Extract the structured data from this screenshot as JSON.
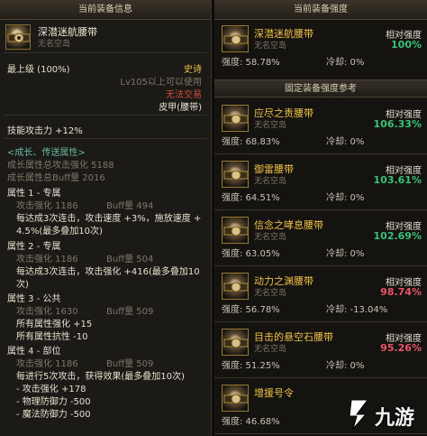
{
  "left": {
    "header": "当前装备信息",
    "item": {
      "name": "深潜迷航腰带",
      "sub": "无名空岛"
    },
    "grade": "最上级 (100%)",
    "rarity": "史诗",
    "level_req": "Lv105以上可以使用",
    "trade": "无法交易",
    "slot": "皮甲(腰带)",
    "skill_atk": "技能攻击力 +12%",
    "growth_title": "<成长、传送属性>",
    "growth_atk": "成长属性总攻击强化 5188",
    "growth_buff": "成长属性总Buff量 2016",
    "attrs": [
      {
        "title": "属性 1 - 专属",
        "atk": "攻击强化  1186",
        "buff": "Buff量  494",
        "desc": [
          "每达成3次连击，攻击速度 +3%，施放速度 +",
          "4.5%(最多叠加10次)"
        ]
      },
      {
        "title": "属性 2 - 专属",
        "atk": "攻击强化  1186",
        "buff": "Buff量  504",
        "desc": [
          "每达成3次连击，攻击强化 +416(最多叠加10",
          "次)"
        ]
      },
      {
        "title": "属性 3 - 公共",
        "atk": "攻击强化  1630",
        "buff": "Buff量  509",
        "desc": [
          "所有属性强化 +15",
          "所有属性抗性 -10"
        ]
      },
      {
        "title": "属性 4 - 部位",
        "atk": "攻击强化  1186",
        "buff": "Buff量  509",
        "desc": [
          "每进行5次攻击，获得效果(最多叠加10次)",
          "- 攻击强化 +178",
          "- 物理防御力 -500",
          "- 魔法防御力 -500"
        ]
      }
    ]
  },
  "right": {
    "header": "当前装备强度",
    "current": {
      "name": "深潜迷航腰带",
      "sub": "无名空岛",
      "rel_label": "相对强度",
      "rel_value": "100%",
      "strength": "强度: 58.78%",
      "cd": "冷却: 0%"
    },
    "ref_header": "固定装备强度参考",
    "refs": [
      {
        "name": "应尽之责腰带",
        "sub": "无名空岛",
        "rel_label": "相对强度",
        "rel_value": "106.33%",
        "rel_color": "#3cc07a",
        "strength": "强度: 68.83%",
        "cd": "冷却: 0%"
      },
      {
        "name": "御雷腰带",
        "sub": "无名空岛",
        "rel_label": "相对强度",
        "rel_value": "103.61%",
        "rel_color": "#3cc07a",
        "strength": "强度: 64.51%",
        "cd": "冷却: 0%"
      },
      {
        "name": "信念之哮息腰带",
        "sub": "无名空岛",
        "rel_label": "相对强度",
        "rel_value": "102.69%",
        "rel_color": "#3cc07a",
        "strength": "强度: 63.05%",
        "cd": "冷却: 0%"
      },
      {
        "name": "动力之渊腰带",
        "sub": "无名空岛",
        "rel_label": "相对强度",
        "rel_value": "98.74%",
        "rel_color": "#e8546a",
        "strength": "强度: 56.78%",
        "cd": "冷却: -13.04%"
      },
      {
        "name": "目击的悬空石腰带",
        "sub": "无名空岛",
        "rel_label": "相对强度",
        "rel_value": "95.26%",
        "rel_color": "#e8546a",
        "strength": "强度: 51.25%",
        "cd": "冷却: 0%"
      },
      {
        "name": "增援号令",
        "sub": "",
        "rel_label": "",
        "rel_value": "",
        "rel_color": "#e8546a",
        "strength": "强度: 46.68%",
        "cd": ""
      }
    ]
  },
  "watermark": {
    "text": "九游",
    "color": "#ffffff"
  }
}
